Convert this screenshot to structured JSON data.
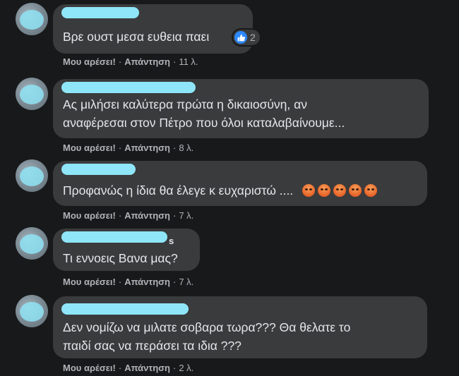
{
  "comments": [
    {
      "text_lines": [
        "Βρε ουστ μεσα ευθεια παει"
      ],
      "reactions": {
        "icon": "like-icon",
        "count": "2"
      },
      "actions": {
        "like": "Μου αρέσει!",
        "reply": "Απάντηση",
        "time": "11 λ."
      }
    },
    {
      "text_lines": [
        "Ας μιλήσει καλύτερα πρώτα η δικαιοσύνη, αν",
        "αναφέρεσαι στον Πέτρο που όλοι καταλαβαίνουμε..."
      ],
      "actions": {
        "like": "Μου αρέσει!",
        "reply": "Απάντηση",
        "time": "8 λ."
      }
    },
    {
      "text_lines": [
        "Προφανώς η ίδια θα έλεγε κ ευχαριστώ ...."
      ],
      "emoji": "angry-face-icon",
      "actions": {
        "like": "Μου αρέσει!",
        "reply": "Απάντηση",
        "time": "7 λ."
      }
    },
    {
      "name_suffix": "s",
      "text_lines": [
        "Τι εννοεις Βανα μας?"
      ],
      "actions": {
        "like": "Μου αρέσει!",
        "reply": "Απάντηση",
        "time": "7 λ."
      }
    },
    {
      "text_lines": [
        "Δεν νομίζω να μιλατε σοβαρα τωρα??? Θα θελατε το",
        "παιδί σας να περάσει τα ιδια ???"
      ],
      "actions": {
        "like": "Μου αρέσει!",
        "reply": "Απάντηση",
        "time": "2 λ."
      }
    }
  ],
  "colors": {
    "background": "#18191a",
    "bubble": "#3a3b3c",
    "text": "#e4e6eb",
    "meta": "#b0b3b8",
    "like_blue": "#2d88ff",
    "redaction": "#8ee6f8"
  }
}
